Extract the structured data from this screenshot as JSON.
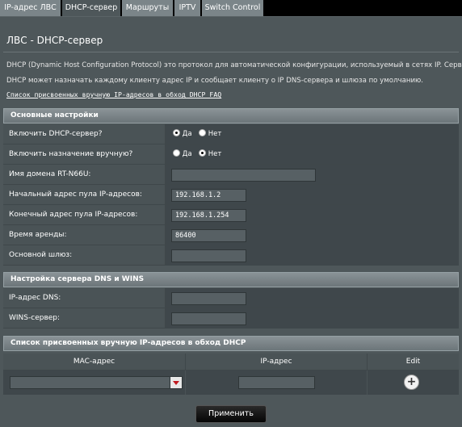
{
  "tabs": [
    "IP-адрес ЛВС",
    "DHCP-сервер",
    "Маршруты",
    "IPTV",
    "Switch Control"
  ],
  "active_tab": "DHCP-сервер",
  "page_title": "ЛВС - DHCP-сервер",
  "description": [
    "DHCP (Dynamic Host Configuration Protocol) это протокол для автоматической конфигурации, используемый в сетях IP. Сервер",
    "DHCP может назначать каждому клиенту адрес IP и сообщает клиенту о IP DNS-сервера и шлюза по умолчанию."
  ],
  "faq_link": "Список присвоенных вручную IP-адресов в обход DHCP FAQ",
  "basic": {
    "section_title": "Основные настройки",
    "enable_dhcp_label": "Включить DHCP-сервер?",
    "enable_manual_label": "Включить назначение вручную?",
    "yes": "Да",
    "no": "Нет",
    "domain_label": "Имя домена RT-N66U:",
    "domain_value": "",
    "start_label": "Начальный адрес пула IP-адресов:",
    "start_value": "192.168.1.2",
    "end_label": "Конечный адрес пула IP-адресов:",
    "end_value": "192.168.1.254",
    "lease_label": "Время аренды:",
    "lease_value": "86400",
    "gateway_label": "Основной шлюз:",
    "gateway_value": ""
  },
  "dns": {
    "section_title": "Настройка сервера DNS и WINS",
    "dns_label": "IP-адрес DNS:",
    "dns_value": "",
    "wins_label": "WINS-сервер:",
    "wins_value": ""
  },
  "manual": {
    "section_title": "Список присвоенных вручную IP-адресов в обход DHCP",
    "col_mac": "MAC-адрес",
    "col_ip": "IP-адрес",
    "col_edit": "Edit"
  },
  "apply_label": "Применить"
}
